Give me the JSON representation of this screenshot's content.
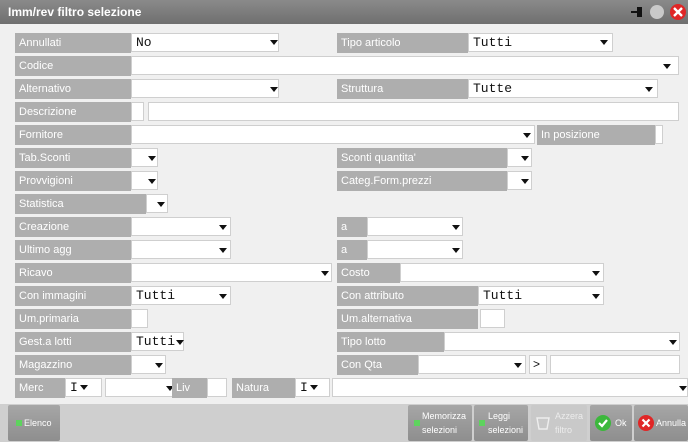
{
  "window": {
    "title": "Imm/rev filtro selezione"
  },
  "fields": {
    "annullati": {
      "label": "Annullati",
      "value": "No"
    },
    "tipo_articolo": {
      "label": "Tipo articolo",
      "value": "Tutti"
    },
    "codice": {
      "label": "Codice",
      "value": ""
    },
    "alternativo": {
      "label": "Alternativo",
      "value": ""
    },
    "struttura": {
      "label": "Struttura",
      "value": "Tutte"
    },
    "descrizione": {
      "label": "Descrizione",
      "value": ""
    },
    "fornitore": {
      "label": "Fornitore",
      "value": ""
    },
    "in_posizione": {
      "label": "In posizione",
      "value": ""
    },
    "tab_sconti": {
      "label": "Tab.Sconti",
      "value": ""
    },
    "sconti_quantita": {
      "label": "Sconti quantita'",
      "value": ""
    },
    "provvigioni": {
      "label": "Provvigioni",
      "value": ""
    },
    "categ_form_prezzi": {
      "label": "Categ.Form.prezzi",
      "value": ""
    },
    "statistica": {
      "label": "Statistica",
      "value": ""
    },
    "creazione": {
      "label": "Creazione",
      "value": "",
      "a_label": "a",
      "a_value": ""
    },
    "ultimo_agg": {
      "label": "Ultimo agg",
      "value": "",
      "a_label": "a",
      "a_value": ""
    },
    "ricavo": {
      "label": "Ricavo",
      "value": ""
    },
    "costo": {
      "label": "Costo",
      "value": ""
    },
    "con_immagini": {
      "label": "Con immagini",
      "value": "Tutti"
    },
    "con_attributo": {
      "label": "Con attributo",
      "value": "Tutti"
    },
    "um_primaria": {
      "label": "Um.primaria",
      "value": ""
    },
    "um_alternativa": {
      "label": "Um.alternativa",
      "value": ""
    },
    "gest_lotti": {
      "label": "Gest.a lotti",
      "value": "Tutti"
    },
    "tipo_lotto": {
      "label": "Tipo lotto",
      "value": ""
    },
    "magazzino": {
      "label": "Magazzino",
      "value": ""
    },
    "con_qta": {
      "label": "Con Qta",
      "value": "",
      "op": ">",
      "qty": ""
    },
    "merc": {
      "label": "Merc",
      "op": "I",
      "value": ""
    },
    "liv": {
      "label": "Liv",
      "value": ""
    },
    "natura": {
      "label": "Natura",
      "op": "I",
      "value": ""
    }
  },
  "buttons": {
    "elenco": "Elenco",
    "memorizza": [
      "Memorizza",
      "selezioni"
    ],
    "leggi": [
      "Leggi",
      "selezioni"
    ],
    "azzera": [
      "Azzera",
      "filtro"
    ],
    "ok": "Ok",
    "annulla": "Annulla"
  },
  "colors": {
    "label_bg": "#aeaeae",
    "title_bg": "#7a7a7a",
    "ok_green": "#3cb83c",
    "cancel_red": "#e02626"
  }
}
